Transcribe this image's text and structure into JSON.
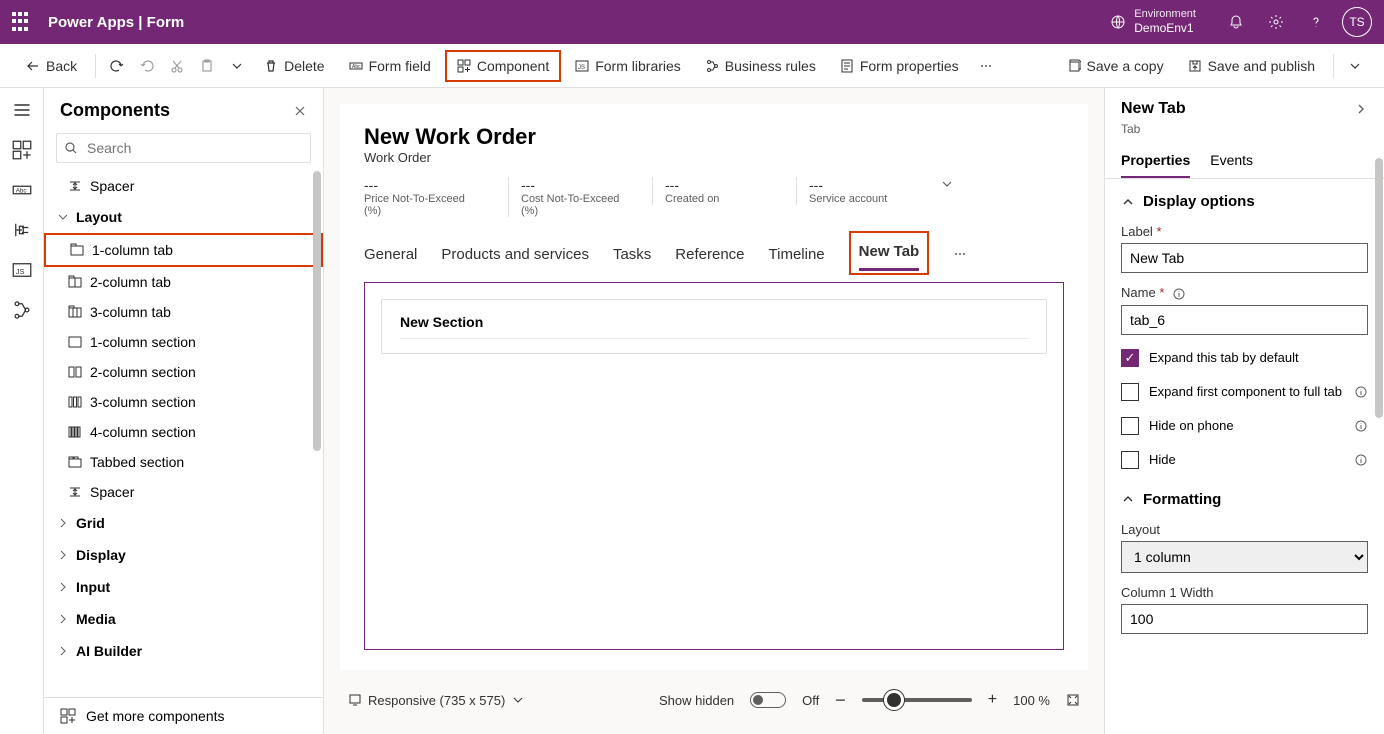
{
  "header": {
    "app_title": "Power Apps  |  Form",
    "env_label": "Environment",
    "env_name": "DemoEnv1",
    "avatar": "TS"
  },
  "commands": {
    "back": "Back",
    "delete": "Delete",
    "form_field": "Form field",
    "component": "Component",
    "form_libraries": "Form libraries",
    "business_rules": "Business rules",
    "form_properties": "Form properties",
    "save_copy": "Save a copy",
    "save_publish": "Save and publish"
  },
  "components": {
    "title": "Components",
    "search_placeholder": "Search",
    "items": {
      "spacer1": "Spacer",
      "layout_group": "Layout",
      "col1tab": "1-column tab",
      "col2tab": "2-column tab",
      "col3tab": "3-column tab",
      "col1sec": "1-column section",
      "col2sec": "2-column section",
      "col3sec": "3-column section",
      "col4sec": "4-column section",
      "tabbed_sec": "Tabbed section",
      "spacer2": "Spacer",
      "grid": "Grid",
      "display": "Display",
      "input": "Input",
      "media": "Media",
      "ai": "AI Builder"
    },
    "footer": "Get more components"
  },
  "form": {
    "title": "New Work Order",
    "subtitle": "Work Order",
    "header_fields": [
      {
        "val": "---",
        "lbl": "Price Not-To-Exceed (%)"
      },
      {
        "val": "---",
        "lbl": "Cost Not-To-Exceed (%)"
      },
      {
        "val": "---",
        "lbl": "Created on"
      },
      {
        "val": "---",
        "lbl": "Service account"
      }
    ],
    "tabs": [
      "General",
      "Products and services",
      "Tasks",
      "Reference",
      "Timeline",
      "New Tab"
    ],
    "section_title": "New Section"
  },
  "canvas_footer": {
    "responsive": "Responsive (735 x 575)",
    "show_hidden": "Show hidden",
    "off": "Off",
    "zoom": "100 %"
  },
  "props": {
    "title": "New Tab",
    "breadcrumb": "Tab",
    "tab_properties": "Properties",
    "tab_events": "Events",
    "display_options": "Display options",
    "label_lbl": "Label",
    "label_val": "New Tab",
    "name_lbl": "Name",
    "name_val": "tab_6",
    "expand_default": "Expand this tab by default",
    "expand_first": "Expand first component to full tab",
    "hide_phone": "Hide on phone",
    "hide": "Hide",
    "formatting": "Formatting",
    "layout_lbl": "Layout",
    "layout_val": "1 column",
    "col_width_lbl": "Column 1 Width",
    "col_width_val": "100"
  }
}
